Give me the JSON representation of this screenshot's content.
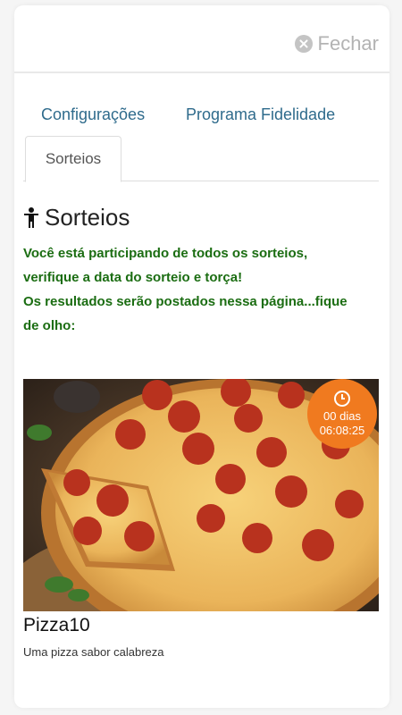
{
  "header": {
    "close_label": "Fechar"
  },
  "tabs": [
    {
      "label": "Configurações"
    },
    {
      "label": "Programa Fidelidade"
    },
    {
      "label": "Sorteios"
    }
  ],
  "section": {
    "title": "Sorteios",
    "icon": "person-icon",
    "message_lines": [
      "Você está participando de todos os sorteios,",
      "verifique a data do sorteio e torça!",
      "Os resultados serão postados nessa página...fique",
      "de olho:"
    ]
  },
  "raffle": {
    "countdown_days": "00 dias",
    "countdown_time": "06:08:25",
    "title": "Pizza10",
    "description": "Uma pizza sabor calabreza"
  },
  "colors": {
    "accent_tab": "#2f6b8c",
    "message": "#1b6d12",
    "badge": "#f07a1f"
  }
}
